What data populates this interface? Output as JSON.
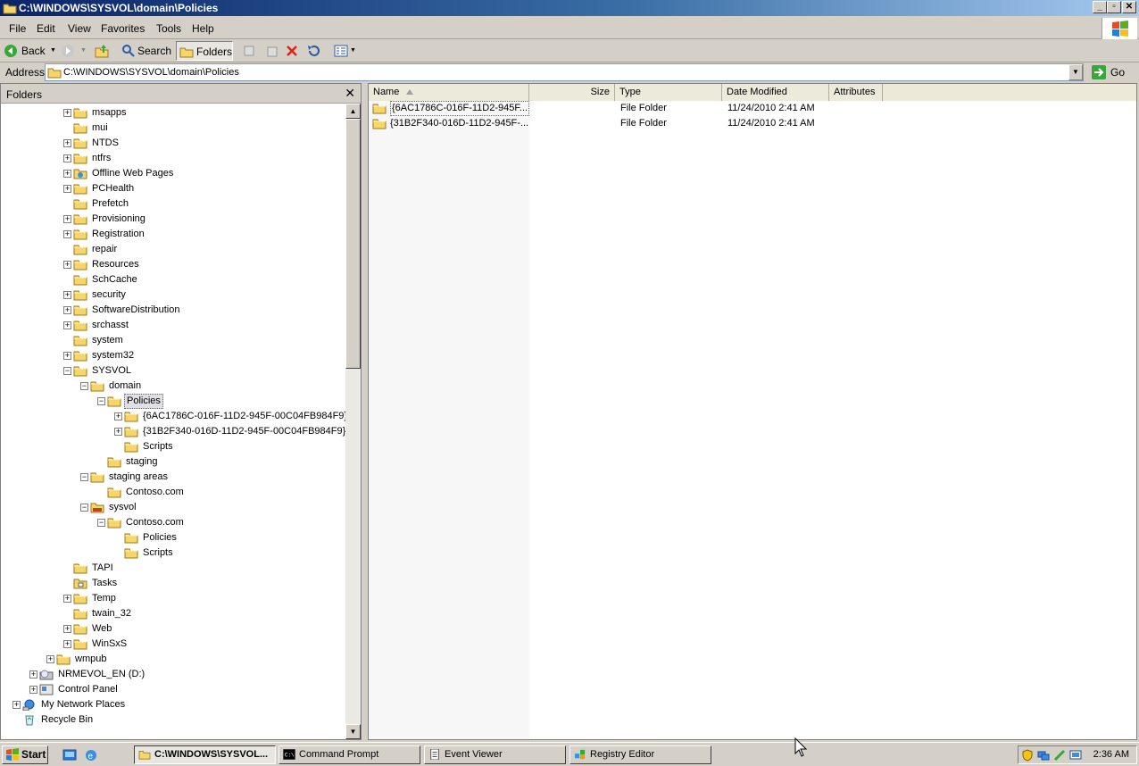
{
  "window": {
    "title": "C:\\WINDOWS\\SYSVOL\\domain\\Policies"
  },
  "menu": {
    "items": [
      "File",
      "Edit",
      "View",
      "Favorites",
      "Tools",
      "Help"
    ]
  },
  "toolbar": {
    "back": "Back",
    "search": "Search",
    "folders": "Folders"
  },
  "address": {
    "label": "Address",
    "value": "C:\\WINDOWS\\SYSVOL\\domain\\Policies",
    "go": "Go"
  },
  "folders_pane": {
    "title": "Folders"
  },
  "tree": [
    {
      "label": "msapps",
      "expander": "plus"
    },
    {
      "label": "mui",
      "expander": ""
    },
    {
      "label": "NTDS",
      "expander": "plus"
    },
    {
      "label": "ntfrs",
      "expander": "plus"
    },
    {
      "label": "Offline Web Pages",
      "expander": "plus"
    },
    {
      "label": "PCHealth",
      "expander": "plus"
    },
    {
      "label": "Prefetch",
      "expander": ""
    },
    {
      "label": "Provisioning",
      "expander": "plus"
    },
    {
      "label": "Registration",
      "expander": "plus"
    },
    {
      "label": "repair",
      "expander": ""
    },
    {
      "label": "Resources",
      "expander": "plus"
    },
    {
      "label": "SchCache",
      "expander": ""
    },
    {
      "label": "security",
      "expander": "plus"
    },
    {
      "label": "SoftwareDistribution",
      "expander": "plus"
    },
    {
      "label": "srchasst",
      "expander": "plus"
    },
    {
      "label": "system",
      "expander": ""
    },
    {
      "label": "system32",
      "expander": "plus"
    },
    {
      "label": "SYSVOL",
      "expander": "minus"
    },
    {
      "label": "domain",
      "expander": "minus"
    },
    {
      "label": "Policies",
      "expander": "minus",
      "selected": true
    },
    {
      "label": "{6AC1786C-016F-11D2-945F-00C04FB984F9}",
      "expander": "plus"
    },
    {
      "label": "{31B2F340-016D-11D2-945F-00C04FB984F9}",
      "expander": "plus"
    },
    {
      "label": "Scripts",
      "expander": ""
    },
    {
      "label": "staging",
      "expander": ""
    },
    {
      "label": "staging areas",
      "expander": "minus"
    },
    {
      "label": "Contoso.com",
      "expander": ""
    },
    {
      "label": "sysvol",
      "expander": "minus"
    },
    {
      "label": "Contoso.com",
      "expander": "minus"
    },
    {
      "label": "Policies",
      "expander": ""
    },
    {
      "label": "Scripts",
      "expander": ""
    },
    {
      "label": "TAPI",
      "expander": ""
    },
    {
      "label": "Tasks",
      "expander": ""
    },
    {
      "label": "Temp",
      "expander": "plus"
    },
    {
      "label": "twain_32",
      "expander": ""
    },
    {
      "label": "Web",
      "expander": "plus"
    },
    {
      "label": "WinSxS",
      "expander": "plus"
    },
    {
      "label": "wmpub",
      "expander": "plus"
    },
    {
      "label": "NRMEVOL_EN (D:)",
      "expander": "plus"
    },
    {
      "label": "Control Panel",
      "expander": "plus"
    },
    {
      "label": "My Network Places",
      "expander": "plus"
    },
    {
      "label": "Recycle Bin",
      "expander": ""
    }
  ],
  "columns": [
    "Name",
    "Size",
    "Type",
    "Date Modified",
    "Attributes"
  ],
  "files": [
    {
      "name": "{6AC1786C-016F-11D2-945F...",
      "size": "",
      "type": "File Folder",
      "modified": "11/24/2010 2:41 AM",
      "attributes": ""
    },
    {
      "name": "{31B2F340-016D-11D2-945F-...",
      "size": "",
      "type": "File Folder",
      "modified": "11/24/2010 2:41 AM",
      "attributes": ""
    }
  ],
  "taskbar": {
    "start": "Start",
    "tasks": [
      "C:\\WINDOWS\\SYSVOL...",
      "Command Prompt",
      "Event Viewer",
      "Registry Editor"
    ],
    "clock": "2:36 AM"
  },
  "colors": {
    "title_start": "#0a246a",
    "title_end": "#a6caf0",
    "folder": "#f6d66a"
  }
}
